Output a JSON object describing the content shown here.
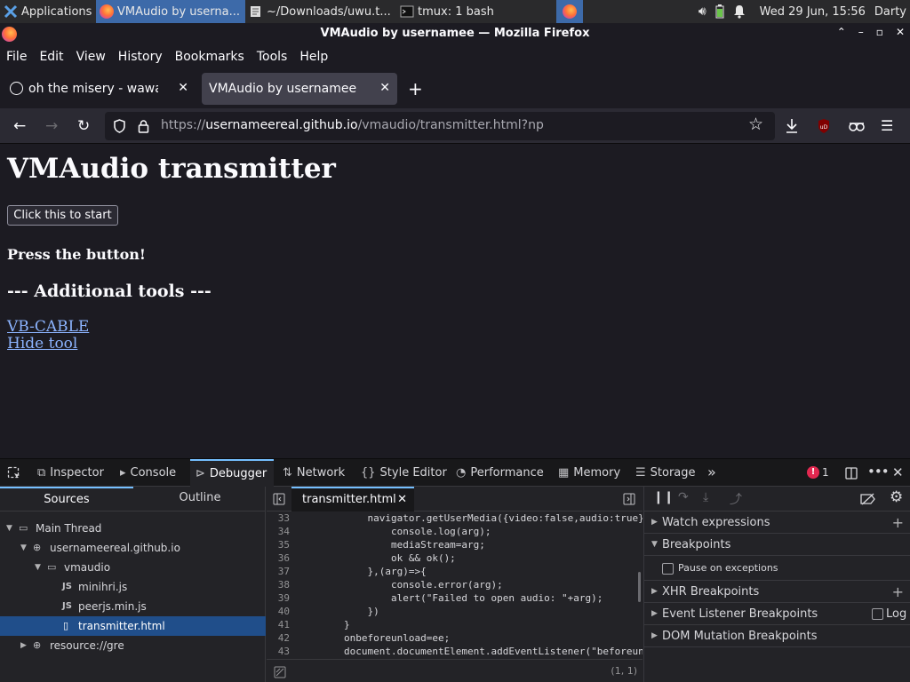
{
  "taskbar": {
    "applications": "Applications",
    "tasks": [
      {
        "label": "VMAudio by userna..."
      },
      {
        "label": "~/Downloads/uwu.t..."
      },
      {
        "label": "tmux: 1 bash"
      }
    ],
    "datetime": "Wed 29 Jun, 15:56",
    "user": "Darty"
  },
  "window": {
    "title": "VMAudio by usernamee — Mozilla Firefox"
  },
  "menu": [
    "File",
    "Edit",
    "View",
    "History",
    "Bookmarks",
    "Tools",
    "Help"
  ],
  "tabs": [
    {
      "title": "oh the misery - wawa cat"
    },
    {
      "title": "VMAudio by usernamee"
    }
  ],
  "url": {
    "scheme": "https://",
    "host": "usernameereal.github.io",
    "path": "/vmaudio/transmitter.html?np"
  },
  "page": {
    "heading": "VMAudio transmitter",
    "start_button": "Click this to start",
    "status": "Press the button!",
    "tools_heading": "--- Additional tools ---",
    "links": [
      "VB-CABLE",
      "Hide tool"
    ]
  },
  "devtools": {
    "tabs": [
      "Inspector",
      "Console",
      "Debugger",
      "Network",
      "Style Editor",
      "Performance",
      "Memory",
      "Storage"
    ],
    "error_count": "1",
    "sources_tabs": [
      "Sources",
      "Outline"
    ],
    "tree": [
      {
        "label": "Main Thread"
      },
      {
        "label": "usernameereal.github.io"
      },
      {
        "label": "vmaudio"
      },
      {
        "label": "minihri.js",
        "icon": "JS"
      },
      {
        "label": "peerjs.min.js",
        "icon": "JS"
      },
      {
        "label": "transmitter.html"
      },
      {
        "label": "resource://gre"
      }
    ],
    "editor_tab": "transmitter.html",
    "code": [
      {
        "n": "33",
        "t": "            navigator.getUserMedia({video:false,audio:true},"
      },
      {
        "n": "34",
        "t": "                console.log(arg);"
      },
      {
        "n": "35",
        "t": "                mediaStream=arg;"
      },
      {
        "n": "36",
        "t": "                ok && ok();"
      },
      {
        "n": "37",
        "t": "            },(arg)=>{"
      },
      {
        "n": "38",
        "t": "                console.error(arg);"
      },
      {
        "n": "39",
        "t": "                alert(\"Failed to open audio: \"+arg);"
      },
      {
        "n": "40",
        "t": "            })"
      },
      {
        "n": "41",
        "t": "        }"
      },
      {
        "n": "42",
        "t": "        onbeforeunload=ee;"
      },
      {
        "n": "43",
        "t": "        document.documentElement.addEventListener(\"beforeunload\""
      }
    ],
    "cursor_pos": "(1, 1)",
    "right_panel": {
      "watch": "Watch expressions",
      "breakpoints": "Breakpoints",
      "pause_exceptions": "Pause on exceptions",
      "xhr": "XHR Breakpoints",
      "event_listener": "Event Listener Breakpoints",
      "log": "Log",
      "dom_mutation": "DOM Mutation Breakpoints"
    }
  },
  "colors": {
    "accent": "#75bfff",
    "link": "#8cb4ff",
    "selection": "#204e8a",
    "taskbar_active": "#3d6aa9"
  }
}
